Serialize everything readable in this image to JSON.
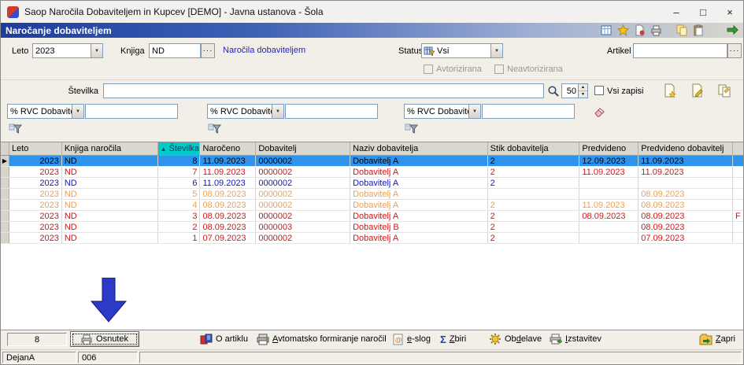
{
  "colors": {
    "header_gradient_start": "#1c3d9c",
    "selected_row_bg": "#2f93ec",
    "row_red": "#d81414",
    "row_blue": "#1414cc",
    "row_orange": "#ef9f4e",
    "sorted_column_header_bg": "#00cbcb",
    "link_blue": "#2222cc",
    "annotation_arrow_blue": "#2c3ac8"
  },
  "window": {
    "title": "Saop  Naročila Dobaviteljem in Kupcev [DEMO] - Javna ustanova - Šola",
    "buttons": {
      "minimize": "–",
      "maximize": "□",
      "close": "×"
    }
  },
  "appbar": {
    "title": "Naročanje dobaviteljem",
    "icons": [
      "table-icon",
      "star-icon",
      "report-icon",
      "printer-icon",
      "copy-icon",
      "paste-icon",
      "exchange-icon"
    ]
  },
  "filters": {
    "leto": {
      "label": "Leto",
      "value": "2023"
    },
    "knjiga": {
      "label": "Knjiga",
      "value": "ND",
      "ellipsis": "···"
    },
    "link_text": "Naročila dobaviteljem",
    "status": {
      "label": "Status",
      "value": "Vsi"
    },
    "artikel": {
      "label": "Artikel",
      "value": "",
      "ellipsis": "···"
    },
    "avtorizirana_label": "Avtorizirana",
    "neavtorizirana_label": "Neavtorizirana"
  },
  "search": {
    "label": "Številka",
    "value": "",
    "page_size": "50",
    "vsi_zapisi_label": "Vsi zapisi",
    "record_icons": [
      "new-record-icon",
      "edit-record-icon",
      "copy-record-icon"
    ]
  },
  "rvc_filters": [
    {
      "combo": "% RVC Dobavitelj",
      "value": ""
    },
    {
      "combo": "% RVC Dobavitelj",
      "value": ""
    },
    {
      "combo": "% RVC Dobavitelj",
      "value": ""
    }
  ],
  "grid": {
    "sort_indicator": "▲",
    "columns": [
      "Leto",
      "Knjiga naročila",
      "Številka",
      "Naročeno",
      "Dobavitelj",
      "Naziv dobavitelja",
      "Stik dobavitelja",
      "Predvideno",
      "Predvideno dobavitelj"
    ],
    "rows": [
      {
        "selected": true,
        "color": "selected",
        "leto": "2023",
        "knjiga": "ND",
        "stevilka": "8",
        "naroceno": "11.09.2023",
        "dobavitelj": "0000002",
        "naziv": "Dobavitelj A",
        "stik": "2",
        "predvideno": "12.09.2023",
        "predvideno_dobavitelj": "11.09.2023",
        "extra": ""
      },
      {
        "selected": false,
        "color": "red",
        "leto": "2023",
        "knjiga": "ND",
        "stevilka": "7",
        "naroceno": "11.09.2023",
        "dobavitelj": "0000002",
        "naziv": "Dobavitelj A",
        "stik": "2",
        "predvideno": "11.09.2023",
        "predvideno_dobavitelj": "11.09.2023",
        "extra": ""
      },
      {
        "selected": false,
        "color": "blue",
        "leto": "2023",
        "knjiga": "ND",
        "stevilka": "6",
        "naroceno": "11.09.2023",
        "dobavitelj": "0000002",
        "naziv": "Dobavitelj A",
        "stik": "2",
        "predvideno": "",
        "predvideno_dobavitelj": "",
        "extra": ""
      },
      {
        "selected": false,
        "color": "orange",
        "leto": "2023",
        "knjiga": "ND",
        "stevilka": "5",
        "naroceno": "08.09.2023",
        "dobavitelj": "0000002",
        "naziv": "Dobavitelj A",
        "stik": "",
        "predvideno": "",
        "predvideno_dobavitelj": "08.09.2023",
        "extra": ""
      },
      {
        "selected": false,
        "color": "orange",
        "leto": "2023",
        "knjiga": "ND",
        "stevilka": "4",
        "naroceno": "08.09.2023",
        "dobavitelj": "0000002",
        "naziv": "Dobavitelj A",
        "stik": "2",
        "predvideno": "11.09.2023",
        "predvideno_dobavitelj": "08.09.2023",
        "extra": ""
      },
      {
        "selected": false,
        "color": "red",
        "leto": "2023",
        "knjiga": "ND",
        "stevilka": "3",
        "naroceno": "08.09.2023",
        "dobavitelj": "0000002",
        "naziv": "Dobavitelj A",
        "stik": "2",
        "predvideno": "08.09.2023",
        "predvideno_dobavitelj": "08.09.2023",
        "extra": "F"
      },
      {
        "selected": false,
        "color": "red",
        "leto": "2023",
        "knjiga": "ND",
        "stevilka": "2",
        "naroceno": "08.09.2023",
        "dobavitelj": "0000003",
        "naziv": "Dobavitelj B",
        "stik": "2",
        "predvideno": "",
        "predvideno_dobavitelj": "08.09.2023",
        "extra": ""
      },
      {
        "selected": false,
        "color": "red",
        "leto": "2023",
        "knjiga": "ND",
        "stevilka": "1",
        "naroceno": "07.09.2023",
        "dobavitelj": "0000002",
        "naziv": "Dobavitelj A",
        "stik": "2",
        "predvideno": "",
        "predvideno_dobavitelj": "07.09.2023",
        "extra": ""
      }
    ]
  },
  "bottom": {
    "record_count": "8",
    "osnutek": {
      "label": "Osnutek",
      "accel": -1
    },
    "buttons": [
      {
        "label": "O artiklu",
        "accel": -1,
        "icon": "article-info-icon"
      },
      {
        "label": "Avtomatsko formiranje naročil",
        "accel": 0,
        "icon": "auto-orders-icon"
      },
      {
        "label": "e-slog",
        "accel": 0,
        "icon": "eslog-icon"
      },
      {
        "label": "Zbiri",
        "accel": 0,
        "icon": "sum-icon"
      },
      {
        "label": "Obdelave",
        "accel": 2,
        "icon": "process-icon"
      },
      {
        "label": "Izstavitev",
        "accel": 0,
        "icon": "issue-icon"
      },
      {
        "label": "Zapri",
        "accel": 0,
        "icon": "close-folder-icon"
      }
    ]
  },
  "statusbar": {
    "user": "DejanA",
    "code": "006"
  }
}
